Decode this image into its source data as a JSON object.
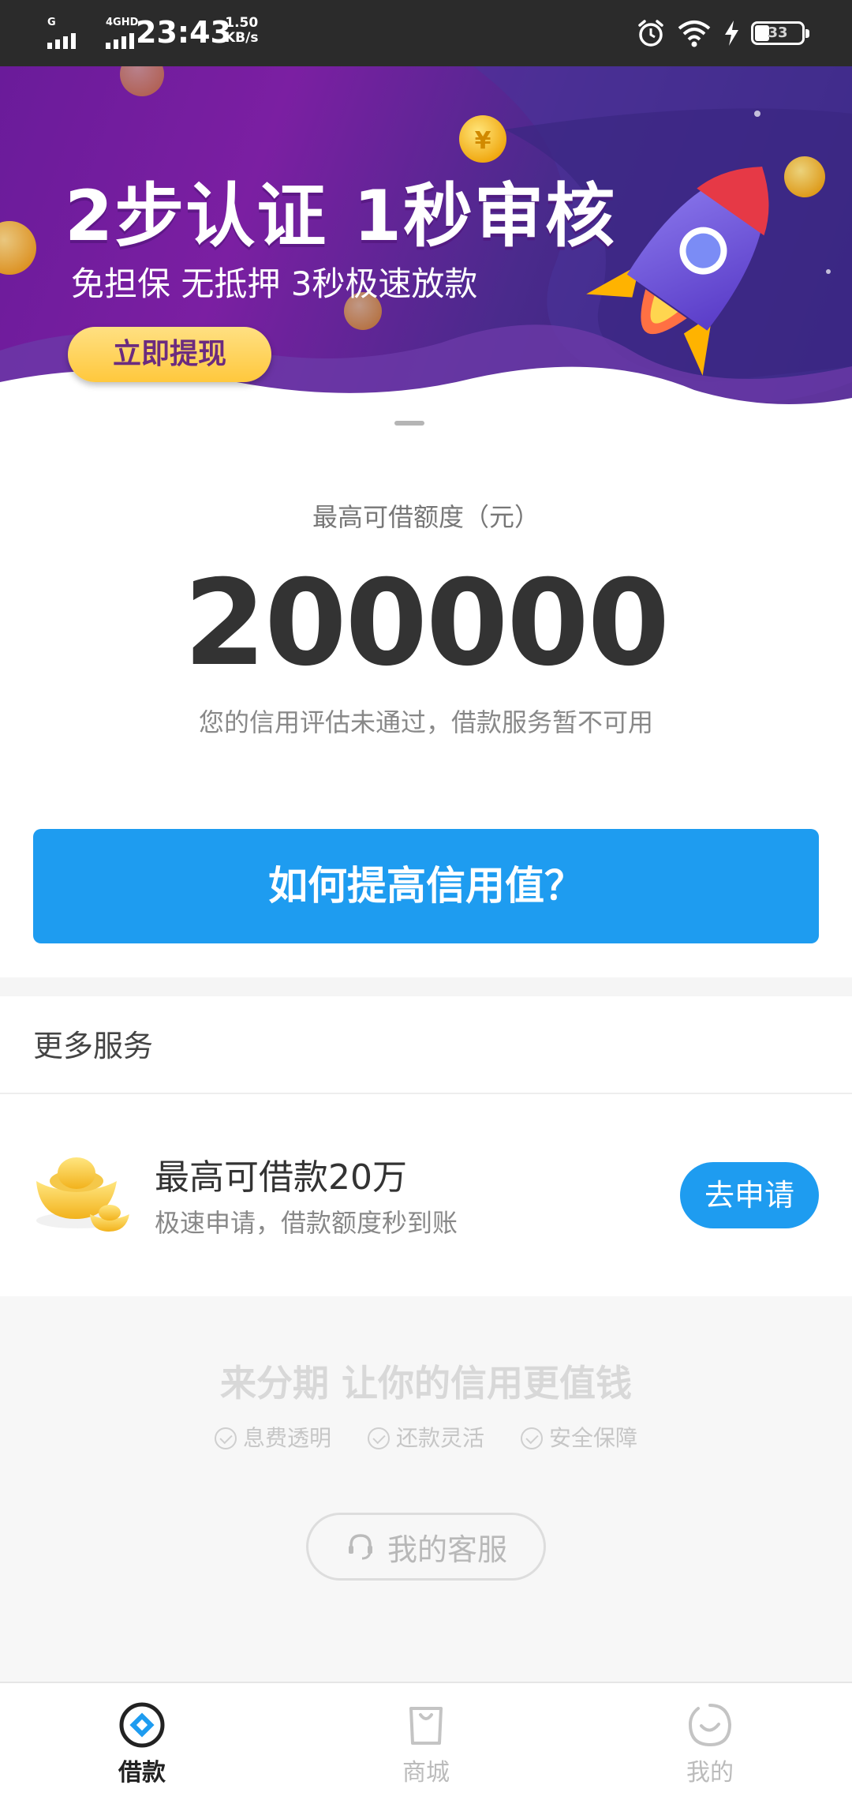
{
  "status_bar": {
    "network_1": "G",
    "network_2": "4GHD",
    "time": "23:43",
    "speed_value": "1.50",
    "speed_unit": "KB/s",
    "battery": "33",
    "icons": [
      "alarm-icon",
      "wifi-icon",
      "charging-icon",
      "battery-icon"
    ]
  },
  "banner": {
    "title": "2步认证 1秒审核",
    "subtitle": "免担保 无抵押 3秒极速放款",
    "button": "立即提现",
    "colors": {
      "background": "#6a1b9a",
      "button": "#ffc83d"
    }
  },
  "credit": {
    "label": "最高可借额度（元）",
    "amount": "200000",
    "note": "您的信用评估未通过，借款服务暂不可用",
    "button": "如何提高信用值？"
  },
  "more_services": {
    "title": "更多服务",
    "item": {
      "title": "最高可借款20万",
      "subtitle": "极速申请，借款额度秒到账",
      "button": "去申请",
      "icon": "gold-ingot-icon"
    }
  },
  "footer": {
    "slogan": "来分期 让你的信用更值钱",
    "features": [
      "息费透明",
      "还款灵活",
      "安全保障"
    ],
    "customer_service": "我的客服"
  },
  "tabs": [
    {
      "label": "借款",
      "icon": "loan-icon",
      "active": true
    },
    {
      "label": "商城",
      "icon": "shop-icon",
      "active": false
    },
    {
      "label": "我的",
      "icon": "profile-icon",
      "active": false
    }
  ],
  "colors": {
    "accent": "#1e9cf0",
    "status_bar": "#2b2b2b"
  }
}
